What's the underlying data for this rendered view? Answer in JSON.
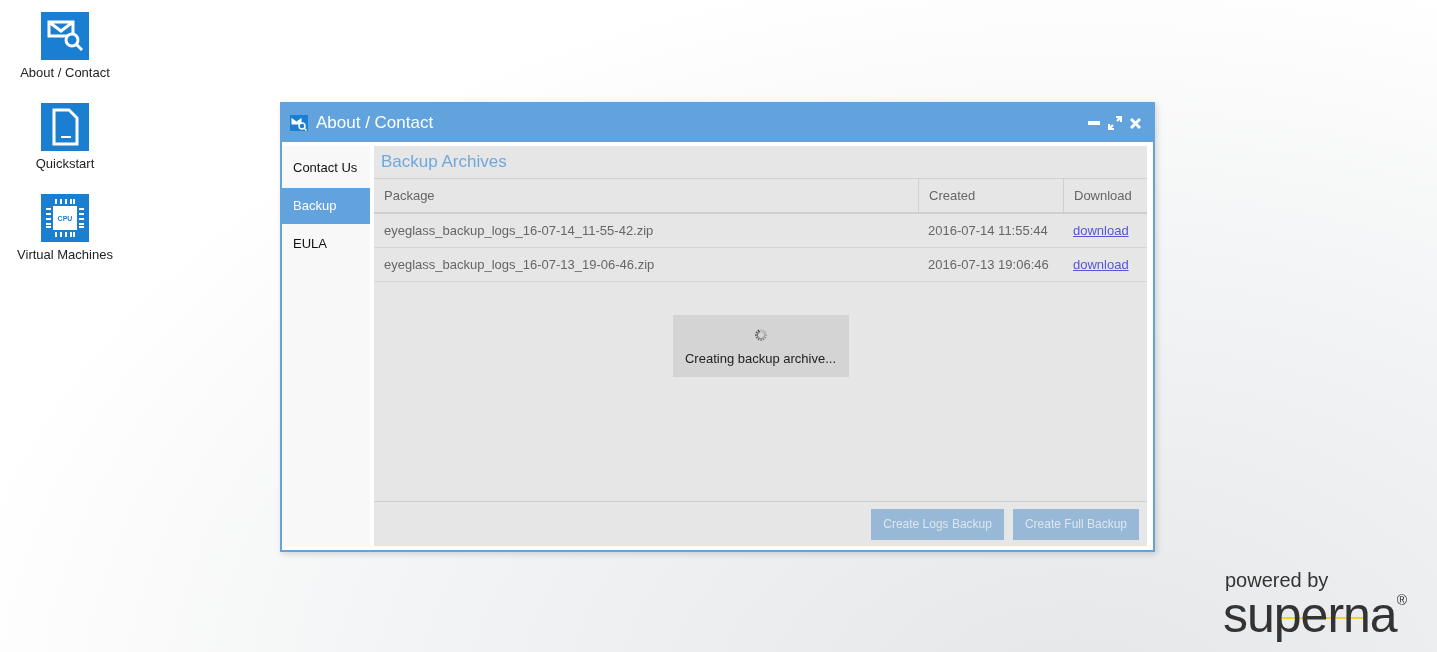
{
  "desktop_icons": [
    {
      "kind": "mail",
      "label": "About / Contact"
    },
    {
      "kind": "document",
      "label": "Quickstart"
    },
    {
      "kind": "chip",
      "label": "Virtual Machines",
      "icon_text": "CPU"
    }
  ],
  "window": {
    "title": "About / Contact",
    "nav": [
      {
        "label": "Contact Us",
        "selected": false
      },
      {
        "label": "Backup",
        "selected": true
      },
      {
        "label": "EULA",
        "selected": false
      }
    ],
    "panel_title": "Backup Archives",
    "table": {
      "columns": [
        "Package",
        "Created",
        "Download"
      ],
      "rows": [
        {
          "package": "eyeglass_backup_logs_16-07-14_11-55-42.zip",
          "created": "2016-07-14 11:55:44",
          "link": "download"
        },
        {
          "package": "eyeglass_backup_logs_16-07-13_19-06-46.zip",
          "created": "2016-07-13 19:06:46",
          "link": "download"
        }
      ]
    },
    "loading": "Creating backup archive...",
    "buttons": [
      {
        "label": "Create Logs Backup",
        "disabled": true
      },
      {
        "label": "Create Full Backup",
        "disabled": true
      }
    ]
  },
  "logo": {
    "tagline": "powered by",
    "name": "superna",
    "mark": "®"
  }
}
